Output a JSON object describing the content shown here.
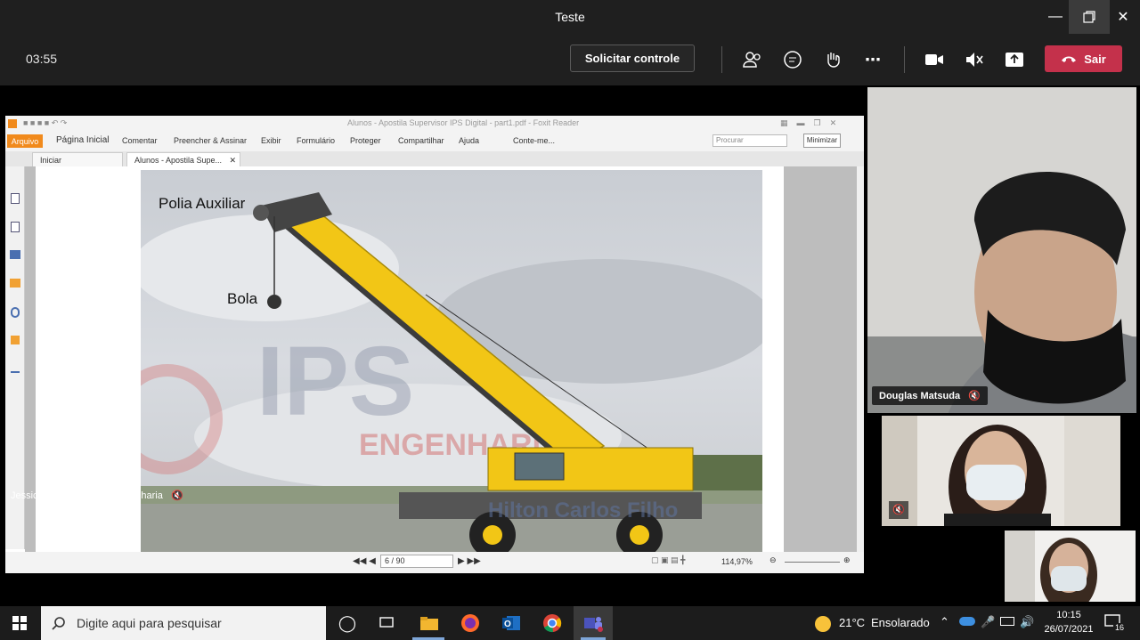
{
  "window": {
    "title": "Teste"
  },
  "meeting": {
    "timer": "03:55",
    "request_control_label": "Solicitar controle",
    "leave_label": "Sair"
  },
  "foxit": {
    "window_title": "Alunos - Apostila Supervisor IPS Digital - part1.pdf - Foxit Reader",
    "tooltip": "Minimizar",
    "menu": [
      "Página Inicial",
      "Comentar",
      "Preencher & Assinar",
      "Exibir",
      "Formulário",
      "Proteger",
      "Compartilhar",
      "Ajuda",
      "Conte-me..."
    ],
    "arquivo": "Arquivo",
    "search_placeholder": "Procurar",
    "tabs": [
      "Iniciar",
      "Alunos - Apostila Supe..."
    ],
    "page_indicator": "6 / 90",
    "zoom": "114,97%"
  },
  "slide": {
    "label_polia": "Polia Auxiliar",
    "label_bola": "Bola",
    "watermark": "ENGENHARIA",
    "watermark2": "Hilton Carlos Filho"
  },
  "presenter": {
    "name": "Jessica Sant'Ana - IPS Engenharia"
  },
  "participants": {
    "p1_name": "Douglas Matsuda"
  },
  "taskbar": {
    "search_placeholder": "Digite aqui para pesquisar",
    "weather_temp": "21°C",
    "weather_desc": "Ensolarado",
    "time": "10:15",
    "date": "26/07/2021",
    "notif_count": "16"
  },
  "colors": {
    "leave": "#c4314b",
    "foxit_orange": "#f18a1c",
    "crane_yellow": "#f2c616"
  }
}
